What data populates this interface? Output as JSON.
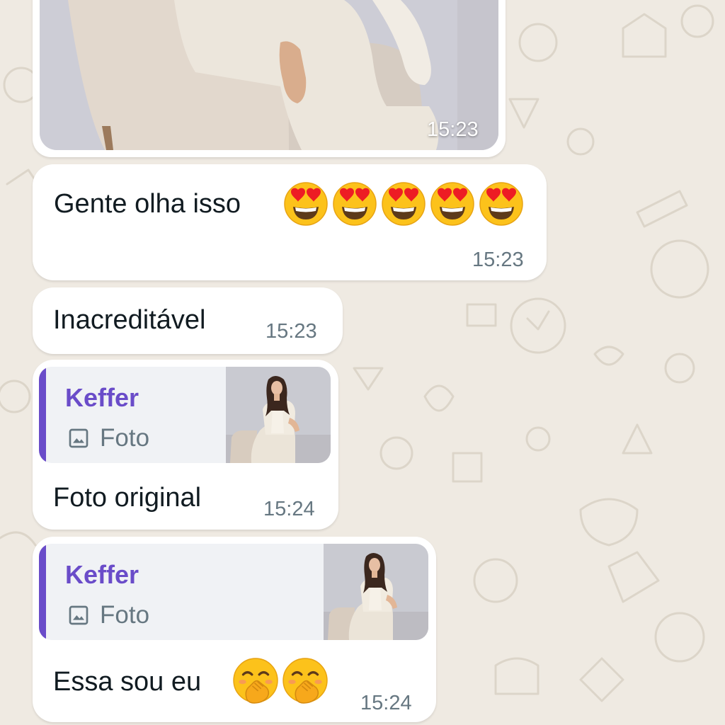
{
  "chat": {
    "messages": [
      {
        "type": "image",
        "time": "15:23"
      },
      {
        "type": "text",
        "text": "Gente olha isso",
        "emoji": [
          "heart-eyes-emoji",
          "heart-eyes-emoji",
          "heart-eyes-emoji",
          "heart-eyes-emoji",
          "heart-eyes-emoji"
        ],
        "time": "15:23"
      },
      {
        "type": "text",
        "text": "Inacreditável",
        "time": "15:23"
      },
      {
        "type": "reply",
        "quote": {
          "author": "Keffer",
          "media_label": "Foto",
          "icon": "image-icon"
        },
        "text": "Foto original",
        "time": "15:24"
      },
      {
        "type": "reply",
        "quote": {
          "author": "Keffer",
          "media_label": "Foto",
          "icon": "image-icon"
        },
        "text": "Essa sou eu",
        "emoji": [
          "hand-over-mouth-emoji",
          "hand-over-mouth-emoji"
        ],
        "time": "15:24"
      }
    ]
  },
  "colors": {
    "wallpaper": "#efeae2",
    "bubble": "#ffffff",
    "quote_accent": "#6a4cc9",
    "timestamp": "#667781"
  }
}
